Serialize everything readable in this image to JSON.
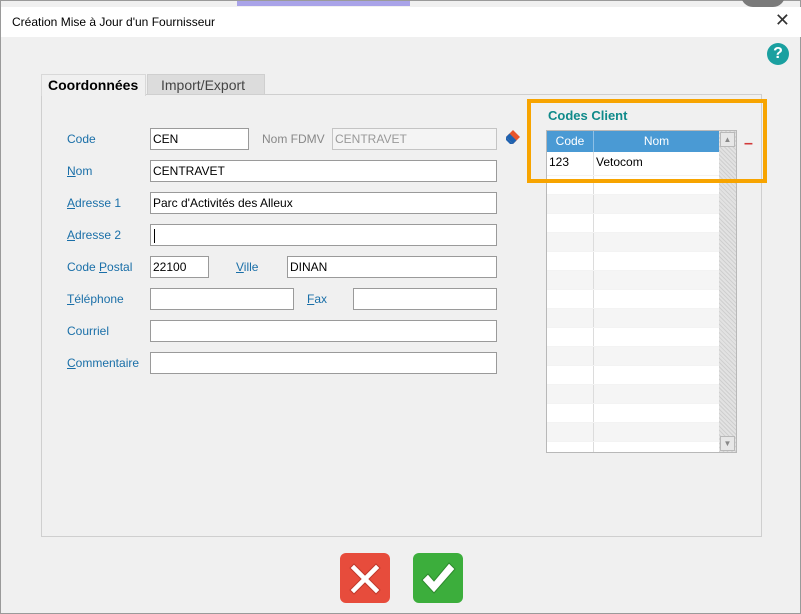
{
  "window": {
    "title": "Création Mise à Jour  d'un Fournisseur"
  },
  "tabs": [
    {
      "label": "Coordonnées",
      "active": true
    },
    {
      "label": "Import/Export",
      "active": false
    }
  ],
  "form": {
    "code": {
      "label": "Code",
      "value": "CEN"
    },
    "nom_fdmv": {
      "label": "Nom FDMV",
      "value": "CENTRAVET"
    },
    "nom": {
      "label_first": "N",
      "label_rest": "om",
      "value": "CENTRAVET"
    },
    "adresse1": {
      "label_first": "A",
      "label_rest": "dresse 1",
      "value": "Parc d'Activités des Alleux"
    },
    "adresse2": {
      "label_first": "A",
      "label_rest": "dresse 2",
      "value": ""
    },
    "code_postal": {
      "label_pre": "Code ",
      "label_first": "P",
      "label_rest": "ostal",
      "value": "22100"
    },
    "ville": {
      "label_first": "V",
      "label_rest": "ille",
      "value": "DINAN"
    },
    "telephone": {
      "label_first": "T",
      "label_rest": "éléphone",
      "value": ""
    },
    "fax": {
      "label_first": "F",
      "label_rest": "ax",
      "value": ""
    },
    "courriel": {
      "label": "Courriel",
      "value": ""
    },
    "commentaire": {
      "label_first": "C",
      "label_rest": "ommentaire",
      "value": ""
    }
  },
  "codes_client": {
    "title": "Codes Client",
    "columns": [
      "Code",
      "Nom"
    ],
    "rows": [
      {
        "code": "123",
        "nom": "Vetocom"
      }
    ],
    "remove_label": "–"
  },
  "help": {
    "label": "?"
  },
  "close": {
    "label": "✕"
  },
  "colors": {
    "accent": "#1aa0a0",
    "link": "#1a6fa8",
    "grid_header": "#4a9ad4",
    "highlight": "#f7a400",
    "cancel": "#e74c3c",
    "ok": "#3cae3c"
  },
  "icons": {
    "help": "help-icon",
    "close": "close-icon",
    "tag": "tag-icon",
    "cancel": "cross-icon",
    "ok": "check-icon"
  }
}
